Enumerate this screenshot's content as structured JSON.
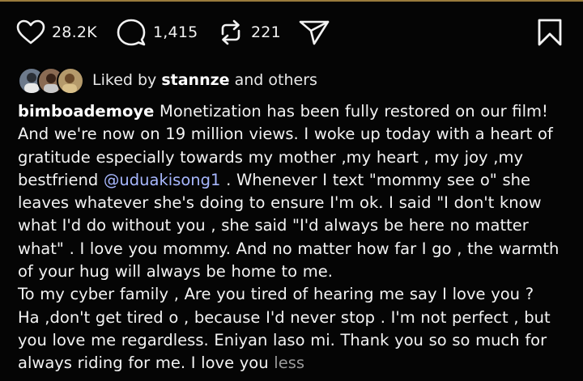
{
  "actions": {
    "likes": "28.2K",
    "comments": "1,415",
    "reposts": "221"
  },
  "liked_by": {
    "prefix": "Liked by",
    "user": "stannze",
    "suffix": "and others"
  },
  "caption": {
    "username": "bimboademoye",
    "text_part1": "Monetization has been fully restored on our film! And we're now on 19 million views. I woke up today with a heart of gratitude especially towards my mother ,my heart , my joy ,my bestfriend",
    "mention": "@uduakisong1",
    "text_part2": ". Whenever I text \"mommy see o\" she leaves whatever she's doing to ensure I'm ok. I said \"I don't know what I'd do without you , she said \"I'd always be here no matter what\" .  I love you mommy. And no matter how far I go , the warmth of your hug will always be home to me.\nTo my cyber family , Are you tired of hearing me say I love you ?\nHa ,don't get tired o , because I'd never stop . I'm not perfect , but you love me regardless. Eniyan laso mi. Thank you so so much for always riding for me. I love you",
    "more_label": "less"
  },
  "colors": {
    "background": "#050505",
    "mention": "#a8b8ff",
    "muted": "#9a9a9a"
  },
  "icons": [
    "heart-icon",
    "comment-icon",
    "repost-icon",
    "share-icon",
    "bookmark-icon"
  ]
}
